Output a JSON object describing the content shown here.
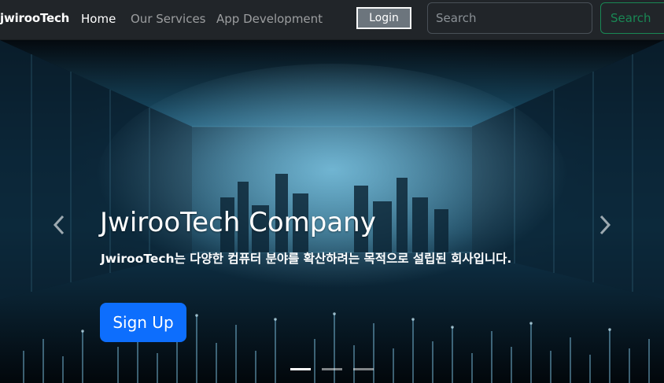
{
  "navbar": {
    "brand": "jwirooTech",
    "links": [
      "Home",
      "Our Services",
      "App Development"
    ],
    "login_label": "Login",
    "search_placeholder": "Search",
    "search_button": "Search"
  },
  "carousel": {
    "title": "JwirooTech Company",
    "text": "JwirooTech는 다양한 컴퓨터 분야를 확산하려는 목적으로 설립된 회사입니다.",
    "signup_label": "Sign Up",
    "slides_count": 3,
    "active_slide": 1
  },
  "colors": {
    "navbar_bg": "#212529",
    "primary": "#0d6efd",
    "success": "#198754"
  }
}
